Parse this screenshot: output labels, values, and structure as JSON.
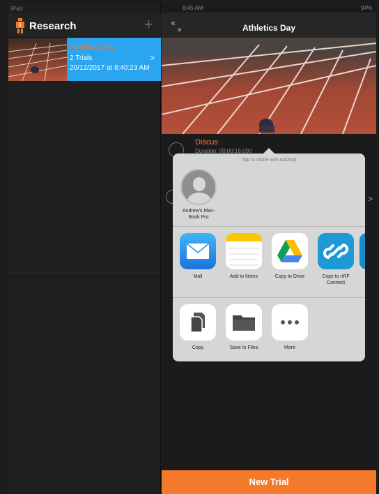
{
  "left_status": "iPad",
  "left_header": {
    "title": "Research",
    "add_label": "+"
  },
  "project": {
    "name": "Athletics Day",
    "trials": "2 Trials",
    "date": "20/12/2017 at 8:40:23 AM"
  },
  "right_status": {
    "time": "8:45 AM",
    "battery": "94%"
  },
  "right_header": {
    "title": "Athletics Day"
  },
  "trial": {
    "name": "Discus",
    "duration": "Duration: 00:00:16.000"
  },
  "share": {
    "airdrop_hint": "Tap to share with AirDrop",
    "airdrop_person": "Andrew's Mac-Book Pro",
    "apps": [
      {
        "label": "Mail",
        "icon": "mail-icon"
      },
      {
        "label": "Add to Notes",
        "icon": "notes-icon"
      },
      {
        "label": "Copy to Drive",
        "icon": "drive-icon"
      },
      {
        "label": "Copy to nRF Connect",
        "icon": "nrf-connect-icon"
      }
    ],
    "actions": [
      {
        "label": "Copy",
        "icon": "copy-icon"
      },
      {
        "label": "Save to Files",
        "icon": "folder-icon"
      },
      {
        "label": "More",
        "icon": "more-icon"
      }
    ]
  },
  "new_trial_label": "New Trial",
  "colors": {
    "accent": "#f5792a",
    "selection": "#2aa5f0",
    "trial_name": "#f07a32"
  }
}
